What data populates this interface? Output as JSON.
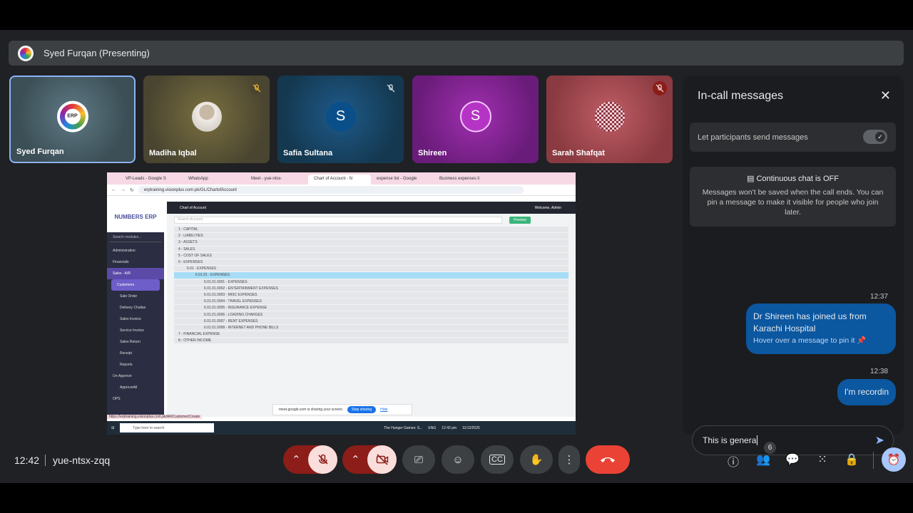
{
  "presenter": {
    "title": "Syed Furqan (Presenting)"
  },
  "tiles": [
    {
      "name": "Syed Furqan",
      "avatar": "ERP"
    },
    {
      "name": "Madiha Iqbal"
    },
    {
      "name": "Safia Sultana",
      "initial": "S"
    },
    {
      "name": "Shireen",
      "initial": "S"
    },
    {
      "name": "Sarah Shafqat"
    }
  ],
  "shared_screen": {
    "tabs": [
      "VP-Leads - Google S",
      "WhatsApp",
      "Meet - yue-ntsx-",
      "Chart of Account - N",
      "expense list - Google",
      "Business expenses li"
    ],
    "url": "erptraining.visionplus.com.pk/GL/ChartofAccount",
    "logo": "NUMBERS ERP",
    "sidebar_search": "Search modules...",
    "sidebar_items": [
      "Administration",
      "Financials",
      "Sales - A/R",
      "Customers",
      "Sale Order",
      "Delivery Challan",
      "Sales Invoice",
      "Service Invoice",
      "Sales Return",
      "Receipt",
      "Reports",
      "Un-Approve",
      "ApproveAll",
      "OPS"
    ],
    "header_title": "Chart of Account",
    "header_right": "Welcome, Admin",
    "search_placeholder": "Search Account",
    "preview_label": "Preview",
    "tree": [
      "1 - CAPITAL",
      "2 - LIABILITIES",
      "3 - ASSETS",
      "4 - SALES",
      "5 - COST OF SALES",
      "6 - EXPENSES",
      "6.01 - EXPENSES",
      "6.01.01 - EXPENSES",
      "6.01.01.0001 - EXPENSES",
      "6.01.01.0002 - ENTERTAINMENT EXPENSES",
      "6.01.01.0003 - MISC EXPENSES",
      "6.01.01.0004 - TRAVEL EXPENSES",
      "6.01.01.0005 - INSURANCE EXPENSE",
      "6.01.01.0006 - LOADING CHARGES",
      "6.01.01.0007 - RENT EXPENSES",
      "6.01.01.0008 - INTERNET AND PHONE BILLS",
      "7 - FINANCIAL EXPENSE",
      "8 - OTHER INCOME"
    ],
    "sharing_note": "meet.google.com is sharing your screen.",
    "stop_sharing": "Stop sharing",
    "hide": "Hide",
    "status_url": "https://erptraining.visionplus.com.pk/AR/Customer/Create",
    "taskbar_search": "Type here to search",
    "taskbar_media": "The Hunger Games: S...",
    "taskbar_lang": "ENG",
    "taskbar_time": "12:42 pm",
    "taskbar_date": "11/12/2025"
  },
  "chat": {
    "title": "In-call messages",
    "toggle_label": "Let participants send messages",
    "info_heading": "Continuous chat is OFF",
    "info_body": "Messages won't be saved when the call ends. You can pin a message to make it visible for people who join later.",
    "messages": [
      {
        "time": "12:37",
        "text": "Dr Shireen has joined us from Karachi Hospital",
        "hint": "Hover over a message to pin it"
      },
      {
        "time": "12:38",
        "text": "I'm recordin"
      }
    ],
    "composer_value": "This is genera"
  },
  "bottom": {
    "time": "12:42",
    "meeting_code": "yue-ntsx-zqq",
    "people_count": "6"
  }
}
